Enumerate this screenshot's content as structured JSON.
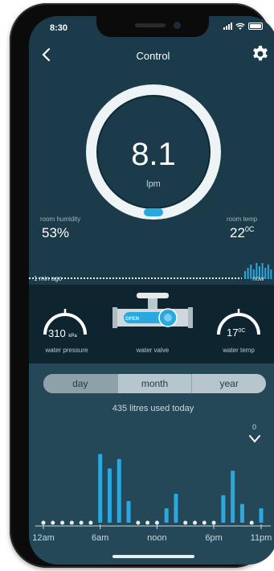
{
  "status": {
    "time": "8:30"
  },
  "nav": {
    "title": "Control"
  },
  "flow": {
    "value": "8.1",
    "unit": "lpm",
    "button": ""
  },
  "humidity": {
    "label": "room humidity",
    "value": "53%"
  },
  "room_temp": {
    "label": "room temp",
    "value": "22",
    "unit": "0C"
  },
  "timeline": {
    "left": "1 min ago",
    "right": "now"
  },
  "gauges": {
    "pressure": {
      "value": "310",
      "unit": "kPa",
      "label": "water pressure"
    },
    "valve": {
      "state": "OPEN",
      "label": "water valve"
    },
    "temp": {
      "value": "17",
      "unit": "0C",
      "label": "water temp"
    }
  },
  "tabs": {
    "day": "day",
    "month": "month",
    "year": "year",
    "active": "day"
  },
  "usage": {
    "text": "435 litres used today"
  },
  "chart_top_value": "0",
  "colors": {
    "accent": "#2aa9e0",
    "bg": "#1b3b4a",
    "band": "#0e2530",
    "lower": "#244858"
  },
  "chart_data": {
    "type": "bar",
    "x_labels": [
      "12am",
      "6am",
      "noon",
      "6pm",
      "11pm"
    ],
    "hours": [
      0,
      1,
      2,
      3,
      4,
      5,
      6,
      7,
      8,
      9,
      10,
      11,
      12,
      13,
      14,
      15,
      16,
      17,
      18,
      19,
      20,
      21,
      22,
      23
    ],
    "values": [
      0,
      0,
      0,
      0,
      0,
      0,
      95,
      75,
      88,
      30,
      0,
      0,
      0,
      20,
      40,
      0,
      0,
      0,
      0,
      38,
      72,
      26,
      0,
      20
    ],
    "zero_marker_color": "#e9eff2",
    "highlight_last": "#f2d21b",
    "ylim": [
      0,
      100
    ]
  }
}
